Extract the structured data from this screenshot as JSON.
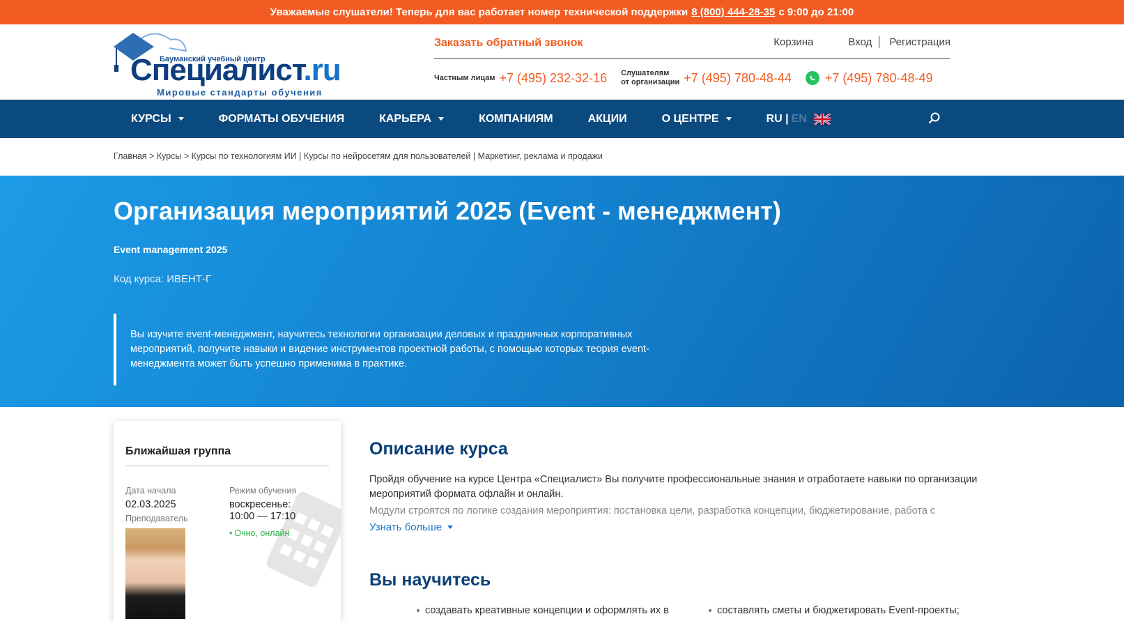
{
  "topbar": {
    "text_before": "Уважаемые слушатели! Теперь для вас работает номер технической поддержки",
    "phone": "8 (800) 444-28-35",
    "text_after": "с 9:00 до 21:00"
  },
  "logo": {
    "brand_top": "Бауманский учебный центр",
    "brand": "Специалист",
    "brand_suffix": ".ru",
    "slogan": "Мировые стандарты обучения"
  },
  "header": {
    "callback": "Заказать обратный звонок",
    "cart": "Корзина",
    "login": "Вход",
    "register": "Регистрация",
    "private_label": "Частным лицам",
    "private_phone": "+7 (495) 232-32-16",
    "org_label_1": "Слушателям",
    "org_label_2": "от организации",
    "org_phone": "+7 (495) 780-48-44",
    "whatsapp_phone": "+7 (495) 780-48-49"
  },
  "nav": {
    "items": [
      {
        "label": "КУРСЫ",
        "dropdown": true
      },
      {
        "label": "ФОРМАТЫ ОБУЧЕНИЯ",
        "dropdown": false
      },
      {
        "label": "КАРЬЕРА",
        "dropdown": true
      },
      {
        "label": "КОМПАНИЯМ",
        "dropdown": false
      },
      {
        "label": "АКЦИИ",
        "dropdown": false
      },
      {
        "label": "О ЦЕНТРЕ",
        "dropdown": true
      }
    ],
    "lang_ru": "RU |",
    "lang_en": "EN"
  },
  "breadcrumb": "Главная > Курсы > Курсы по технологиям ИИ | Курсы по нейросетям для пользователей | Маркетинг, реклама и продажи",
  "hero": {
    "title": "Организация мероприятий 2025 (Event - менеджмент)",
    "subtitle": "Event management 2025",
    "code": "Код курса: ИВЕНТ-Г",
    "quote": "Вы изучите event-менеджмент, научитесь технологии организации деловых и праздничных корпоративных мероприятий, получите навыки и видение инструментов проектной работы, с помощью которых теория event-менеджмента может быть успешно применима в практике."
  },
  "card": {
    "title": "Ближайшая группа",
    "start_label": "Дата начала",
    "start_value": "02.03.2025",
    "mode_label": "Режим обучения",
    "schedule": "воскресенье: 10:00 — 17:10",
    "format": "Очно, онлайн",
    "teacher_label": "Преподаватель"
  },
  "main": {
    "description_title": "Описание курса",
    "description": "Пройдя обучение на курсе Центра «Специалист» Вы получите профессиональные знания и отработаете навыки по организации мероприятий формата офлайн и онлайн.",
    "description_more": "Модули строятся по логике создания мероприятия: постановка цели, разработка концепции, бюджетирование, работа с",
    "more_link": "Узнать больше",
    "learn_title": "Вы научитесь",
    "learn_items": [
      "создавать креативные концепции и оформлять их в",
      "составлять сметы и бюджетировать Event-проекты;"
    ]
  },
  "colors": {
    "accent_orange": "#f25c22",
    "nav_blue": "#0b4a7f",
    "hero_blue": "#1483d0",
    "heading_blue": "#0b3f78",
    "link_blue": "#1a73c8",
    "status_green": "#2bb14a"
  }
}
